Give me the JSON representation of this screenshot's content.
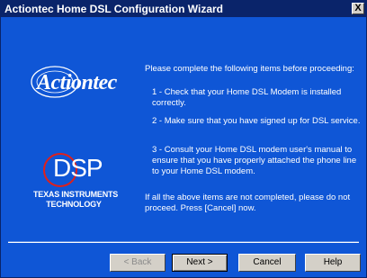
{
  "window": {
    "title": "Actiontec Home DSL Configuration Wizard",
    "close_label": "X"
  },
  "logos": {
    "actiontec_word": "Actiontec",
    "dsp_text": "DSP",
    "ti_line1": "TEXAS INSTRUMENTS",
    "ti_line2": "TECHNOLOGY"
  },
  "content": {
    "intro": "Please complete the following items before proceeding:",
    "item1": "1 - Check that your Home DSL Modem is installed correctly.",
    "item2": "2 - Make sure that you have signed up for DSL service.",
    "item3": "3 - Consult your Home DSL modem user's manual to ensure that you have properly attached the phone line to your Home DSL modem.",
    "warning": "If all the above items are not completed, please do not proceed.  Press [Cancel] now."
  },
  "buttons": {
    "back": "< Back",
    "next": "Next >",
    "cancel": "Cancel",
    "help": "Help"
  },
  "colors": {
    "background": "#0f56d6",
    "titlebar": "#0a246a",
    "text": "#ffffff",
    "button_face": "#d4d0c8"
  }
}
